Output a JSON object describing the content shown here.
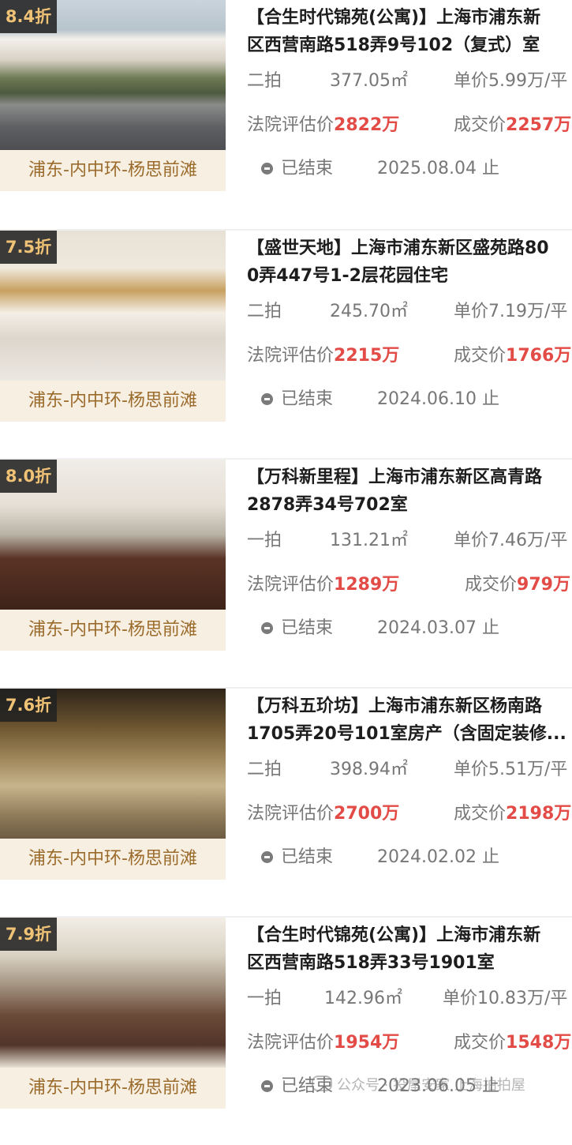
{
  "listings": [
    {
      "discount": "8.4折",
      "region": "浦东-内中环-杨思前滩",
      "title_line1": "【合生时代锦苑(公寓)】上海市浦东新",
      "title_line2": "区西营南路518弄9号102（复式）室",
      "round": "二拍",
      "area": "377.05㎡",
      "unit_price": "单价5.99万/平",
      "eval_label": "法院评估价",
      "eval_value": "2822万",
      "deal_label": "成交价",
      "deal_value": "2257万",
      "status": "已结束",
      "end_date": "2025.08.04 止"
    },
    {
      "discount": "7.5折",
      "region": "浦东-内中环-杨思前滩",
      "title_line1": "【盛世天地】上海市浦东新区盛苑路80",
      "title_line2": "0弄447号1-2层花园住宅",
      "round": "二拍",
      "area": "245.70㎡",
      "unit_price": "单价7.19万/平",
      "eval_label": "法院评估价",
      "eval_value": "2215万",
      "deal_label": "成交价",
      "deal_value": "1766万",
      "status": "已结束",
      "end_date": "2024.06.10 止"
    },
    {
      "discount": "8.0折",
      "region": "浦东-内中环-杨思前滩",
      "title_line1": "【万科新里程】上海市浦东新区高青路",
      "title_line2": "2878弄34号702室",
      "round": "一拍",
      "area": "131.21㎡",
      "unit_price": "单价7.46万/平",
      "eval_label": "法院评估价",
      "eval_value": "1289万",
      "deal_label": "成交价",
      "deal_value": "979万",
      "status": "已结束",
      "end_date": "2024.03.07 止"
    },
    {
      "discount": "7.6折",
      "region": "浦东-内中环-杨思前滩",
      "title_line1": "【万科五玠坊】上海市浦东新区杨南路",
      "title_line2": "1705弄20号101室房产（含固定装修...",
      "round": "二拍",
      "area": "398.94㎡",
      "unit_price": "单价5.51万/平",
      "eval_label": "法院评估价",
      "eval_value": "2700万",
      "deal_label": "成交价",
      "deal_value": "2198万",
      "status": "已结束",
      "end_date": "2024.02.02 止"
    },
    {
      "discount": "7.9折",
      "region": "浦东-内中环-杨思前滩",
      "title_line1": "【合生时代锦苑(公寓)】上海市浦东新",
      "title_line2": "区西营南路518弄33号1901室",
      "round": "一拍",
      "area": "142.96㎡",
      "unit_price": "单价10.83万/平",
      "eval_label": "法院评估价",
      "eval_value": "1954万",
      "deal_label": "成交价",
      "deal_value": "1548万",
      "status": "已结束",
      "end_date": "2023.06.05 止"
    }
  ],
  "watermark": "公众号 · 投屋安家 上海拍拍屋"
}
